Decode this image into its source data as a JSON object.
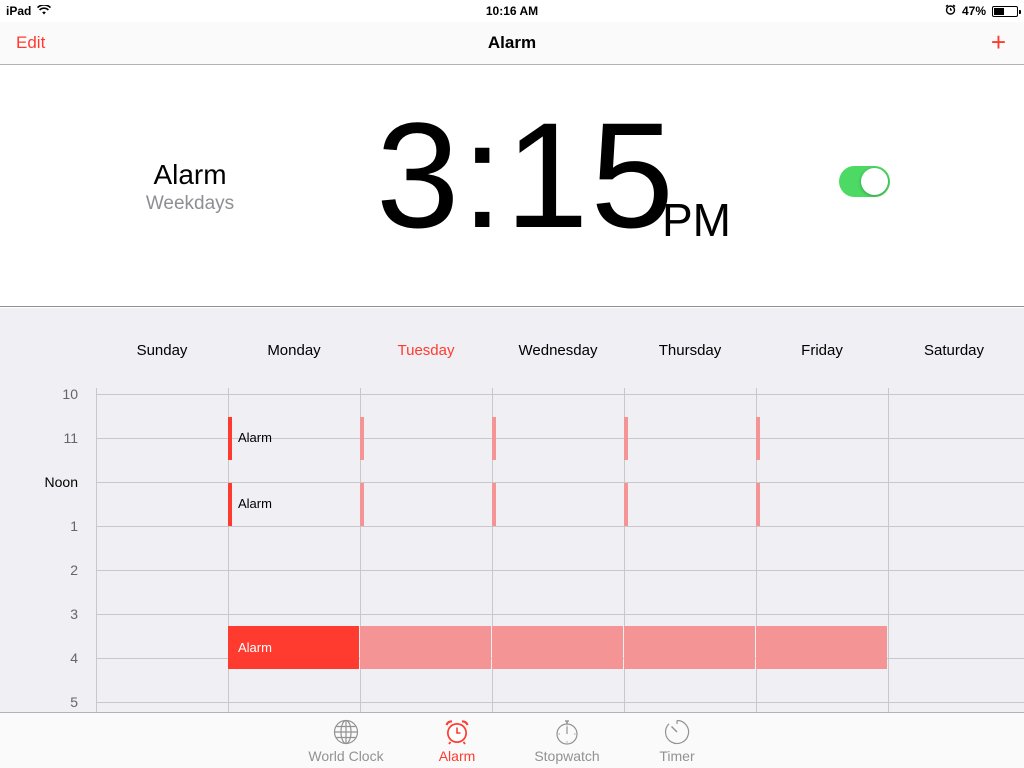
{
  "status": {
    "device": "iPad",
    "time": "10:16 AM",
    "battery_text": "47%",
    "battery_level": 0.47
  },
  "nav": {
    "edit_label": "Edit",
    "title": "Alarm",
    "add_label": "+"
  },
  "alarm": {
    "label": "Alarm",
    "repeat": "Weekdays",
    "time": "3:15",
    "ampm": "PM",
    "enabled": true
  },
  "week": {
    "days": [
      "Sunday",
      "Monday",
      "Tuesday",
      "Wednesday",
      "Thursday",
      "Friday",
      "Saturday"
    ],
    "today_index": 2,
    "hours": [
      "10",
      "11",
      "Noon",
      "1",
      "2",
      "3",
      "4",
      "5"
    ],
    "event_label": "Alarm"
  },
  "tabs": [
    {
      "label": "World Clock",
      "icon": "globe-icon"
    },
    {
      "label": "Alarm",
      "icon": "alarm-clock-icon"
    },
    {
      "label": "Stopwatch",
      "icon": "stopwatch-icon"
    },
    {
      "label": "Timer",
      "icon": "timer-icon"
    }
  ],
  "colors": {
    "accent": "#ff3b30",
    "accent_faded": "#f49494",
    "toggle_on": "#4cd964",
    "grid_bg": "#efeff4"
  }
}
